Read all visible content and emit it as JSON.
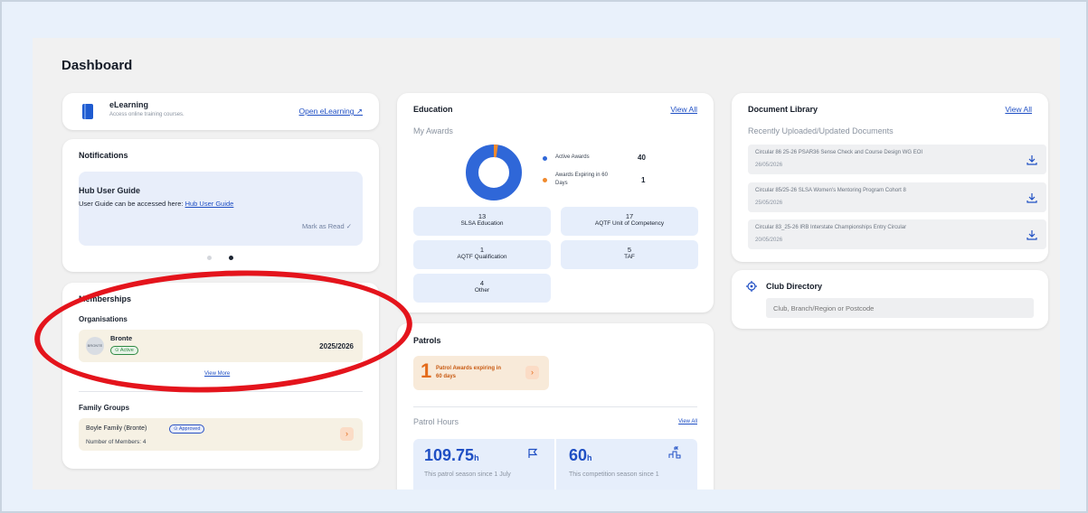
{
  "page": {
    "title": "Dashboard"
  },
  "elearning": {
    "title": "eLearning",
    "subtitle": "Access online training courses.",
    "link_label": "Open eLearning ↗"
  },
  "notifications": {
    "title": "Notifications",
    "item_title": "Hub User Guide",
    "item_text": "User Guide can be accessed here:",
    "item_link": "Hub User Guide",
    "mark_read": "Mark as Read ✓"
  },
  "memberships": {
    "title": "Memberships",
    "organisations_label": "Organisations",
    "org": {
      "logo_text": "BRONTE",
      "name": "Bronte",
      "status": "⊙ Active",
      "season": "2025/2026"
    },
    "view_more": "View More",
    "family_label": "Family Groups",
    "family": {
      "name": "Boyle Family (Bronte)",
      "status": "⊙ Approved",
      "members": "Number of Members: 4"
    }
  },
  "education": {
    "title": "Education",
    "view_all": "View All",
    "subtitle": "My Awards",
    "legend": [
      {
        "label": "Active Awards",
        "value": "40",
        "color": "#2f67d8"
      },
      {
        "label": "Awards Expiring in 60 Days",
        "value": "1",
        "color": "#f08a2d"
      }
    ],
    "donut": {
      "active": 40,
      "expiring": 1
    },
    "stats": [
      {
        "num": "13",
        "label": "SLSA Education"
      },
      {
        "num": "17",
        "label": "AQTF Unit of Competency"
      },
      {
        "num": "1",
        "label": "AQTF Qualification"
      },
      {
        "num": "5",
        "label": "TAF"
      },
      {
        "num": "4",
        "label": "Other"
      }
    ]
  },
  "patrols": {
    "title": "Patrols",
    "expiring_num": "1",
    "expiring_text_1": "Patrol Awards expiring in",
    "expiring_text_2": "60 days",
    "hours_title": "Patrol Hours",
    "hours_view_all": "View All",
    "patrol_hours_value": "109.75",
    "patrol_hours_unit": "h",
    "patrol_hours_desc": "This patrol season since 1 July",
    "comp_hours_value": "60",
    "comp_hours_unit": "h",
    "comp_hours_desc": "This competition season since 1"
  },
  "documents": {
    "title": "Document Library",
    "view_all": "View All",
    "subtitle": "Recently Uploaded/Updated Documents",
    "items": [
      {
        "title": "Circular 86 25-26 PSAR36 Sense Check and Course Design WG EOI",
        "date": "26/05/2026"
      },
      {
        "title": "Circular 85/25-26 SLSA Women's Mentoring Program Cohort 8",
        "date": "25/05/2026"
      },
      {
        "title": "Circular 83_25-26 IRB Interstate Championships Entry Circular",
        "date": "20/05/2026"
      }
    ]
  },
  "club_directory": {
    "title": "Club Directory",
    "placeholder": "Club, Branch/Region or Postcode"
  },
  "colors": {
    "accent": "#1f4fc4",
    "donut_active": "#2f67d8",
    "donut_expiring": "#f08a2d",
    "annotation": "#e4141c"
  }
}
